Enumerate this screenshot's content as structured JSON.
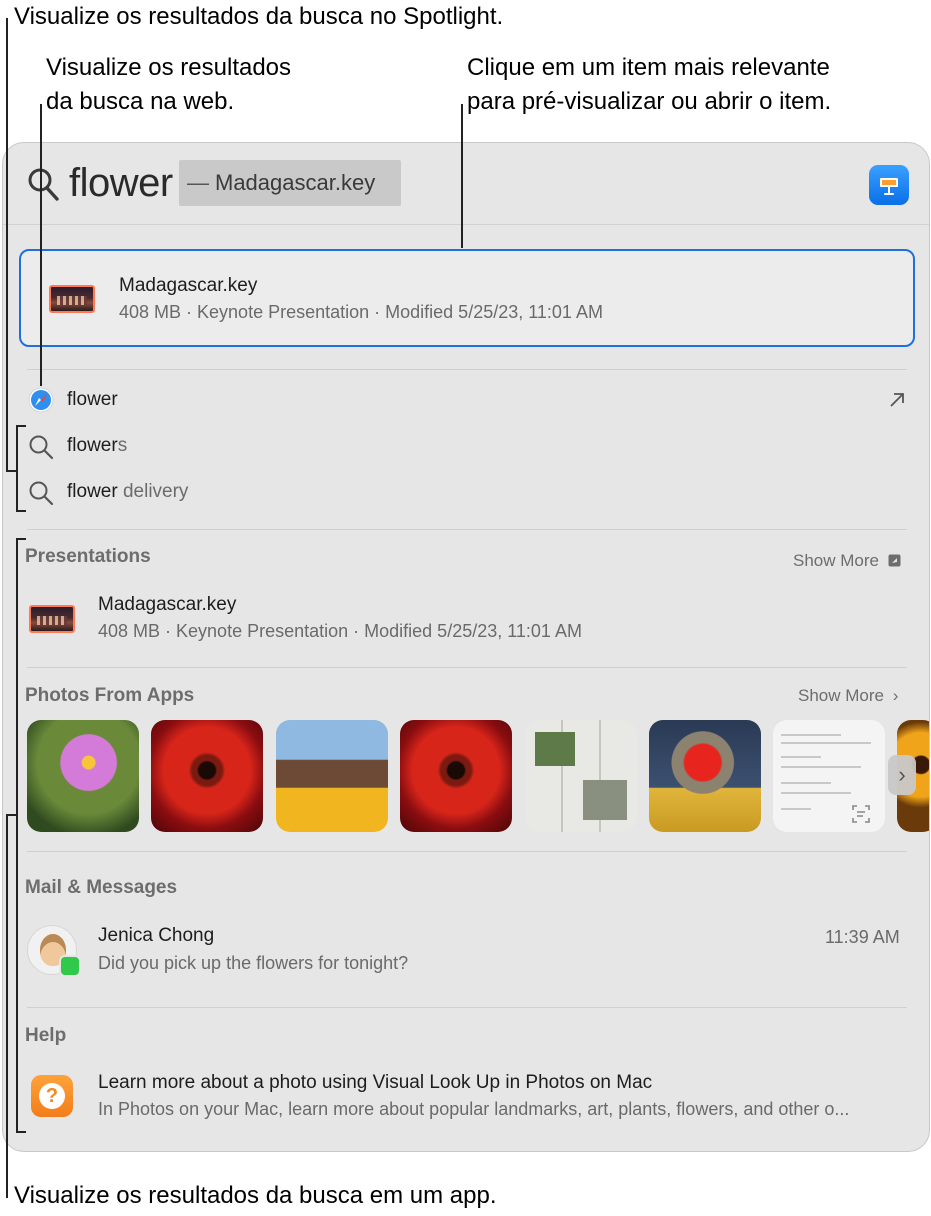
{
  "callouts": {
    "spotlight": "Visualize os resultados da busca no Spotlight.",
    "web_line1": "Visualize os resultados",
    "web_line2": "da busca na web.",
    "tophit_line1": "Clique em um item mais relevante",
    "tophit_line2": "para pré-visualizar ou abrir o item.",
    "app": "Visualize os resultados da busca em um app."
  },
  "search": {
    "query": "flower",
    "completion_dash": "—",
    "completion": "Madagascar.key"
  },
  "top_hit": {
    "title": "Madagascar.key",
    "subtitle": "408 MB · Keynote Presentation · Modified 5/25/23, 11:01 AM"
  },
  "suggestions": [
    {
      "prefix": "flower",
      "suffix": "",
      "icon": "safari-icon"
    },
    {
      "prefix": "flower",
      "suffix": "s",
      "icon": "search-icon"
    },
    {
      "prefix": "flower",
      "suffix": " delivery",
      "icon": "search-icon"
    }
  ],
  "presentations": {
    "header": "Presentations",
    "show_more": "Show More",
    "item_title": "Madagascar.key",
    "item_subtitle": "408 MB · Keynote Presentation · Modified 5/25/23, 11:01 AM"
  },
  "photos": {
    "header": "Photos From Apps",
    "show_more": "Show More"
  },
  "mail": {
    "header": "Mail & Messages",
    "sender": "Jenica Chong",
    "time": "11:39 AM",
    "preview": "Did you pick up the flowers for tonight?"
  },
  "help": {
    "header": "Help",
    "title": "Learn more about a photo using Visual Look Up in Photos on Mac",
    "subtitle": "In Photos on your Mac, learn more about popular landmarks, art, plants, flowers, and other o..."
  },
  "colors": {
    "accent": "#1f6fe0",
    "panel_bg": "#e6e6e6",
    "keynote": "#0a6fe6",
    "help": "#f37d1a",
    "messages": "#30c94a"
  }
}
